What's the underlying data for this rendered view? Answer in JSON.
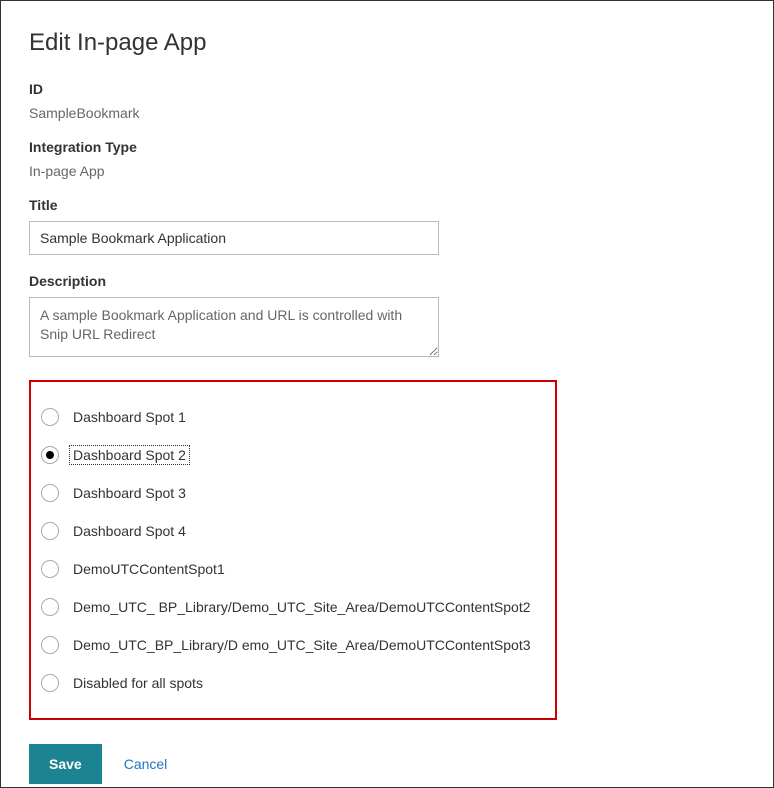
{
  "title": "Edit In-page App",
  "fields": {
    "id": {
      "label": "ID",
      "value": "SampleBookmark"
    },
    "integration_type": {
      "label": "Integration Type",
      "value": "In-page App"
    },
    "title_field": {
      "label": "Title",
      "value": "Sample Bookmark Application"
    },
    "description": {
      "label": "Description",
      "value": "A sample Bookmark Application and URL is controlled with Snip URL Redirect"
    }
  },
  "radio_group": {
    "selected_index": 1,
    "options": [
      {
        "label": "Dashboard Spot 1"
      },
      {
        "label": "Dashboard Spot 2"
      },
      {
        "label": "Dashboard Spot 3"
      },
      {
        "label": "Dashboard Spot 4"
      },
      {
        "label": "DemoUTCContentSpot1"
      },
      {
        "label": "Demo_UTC_ BP_Library/Demo_UTC_Site_Area/DemoUTCContentSpot2"
      },
      {
        "label": "Demo_UTC_BP_Library/D emo_UTC_Site_Area/DemoUTCContentSpot3"
      },
      {
        "label": "Disabled for all spots"
      }
    ]
  },
  "actions": {
    "save": "Save",
    "cancel": "Cancel"
  }
}
